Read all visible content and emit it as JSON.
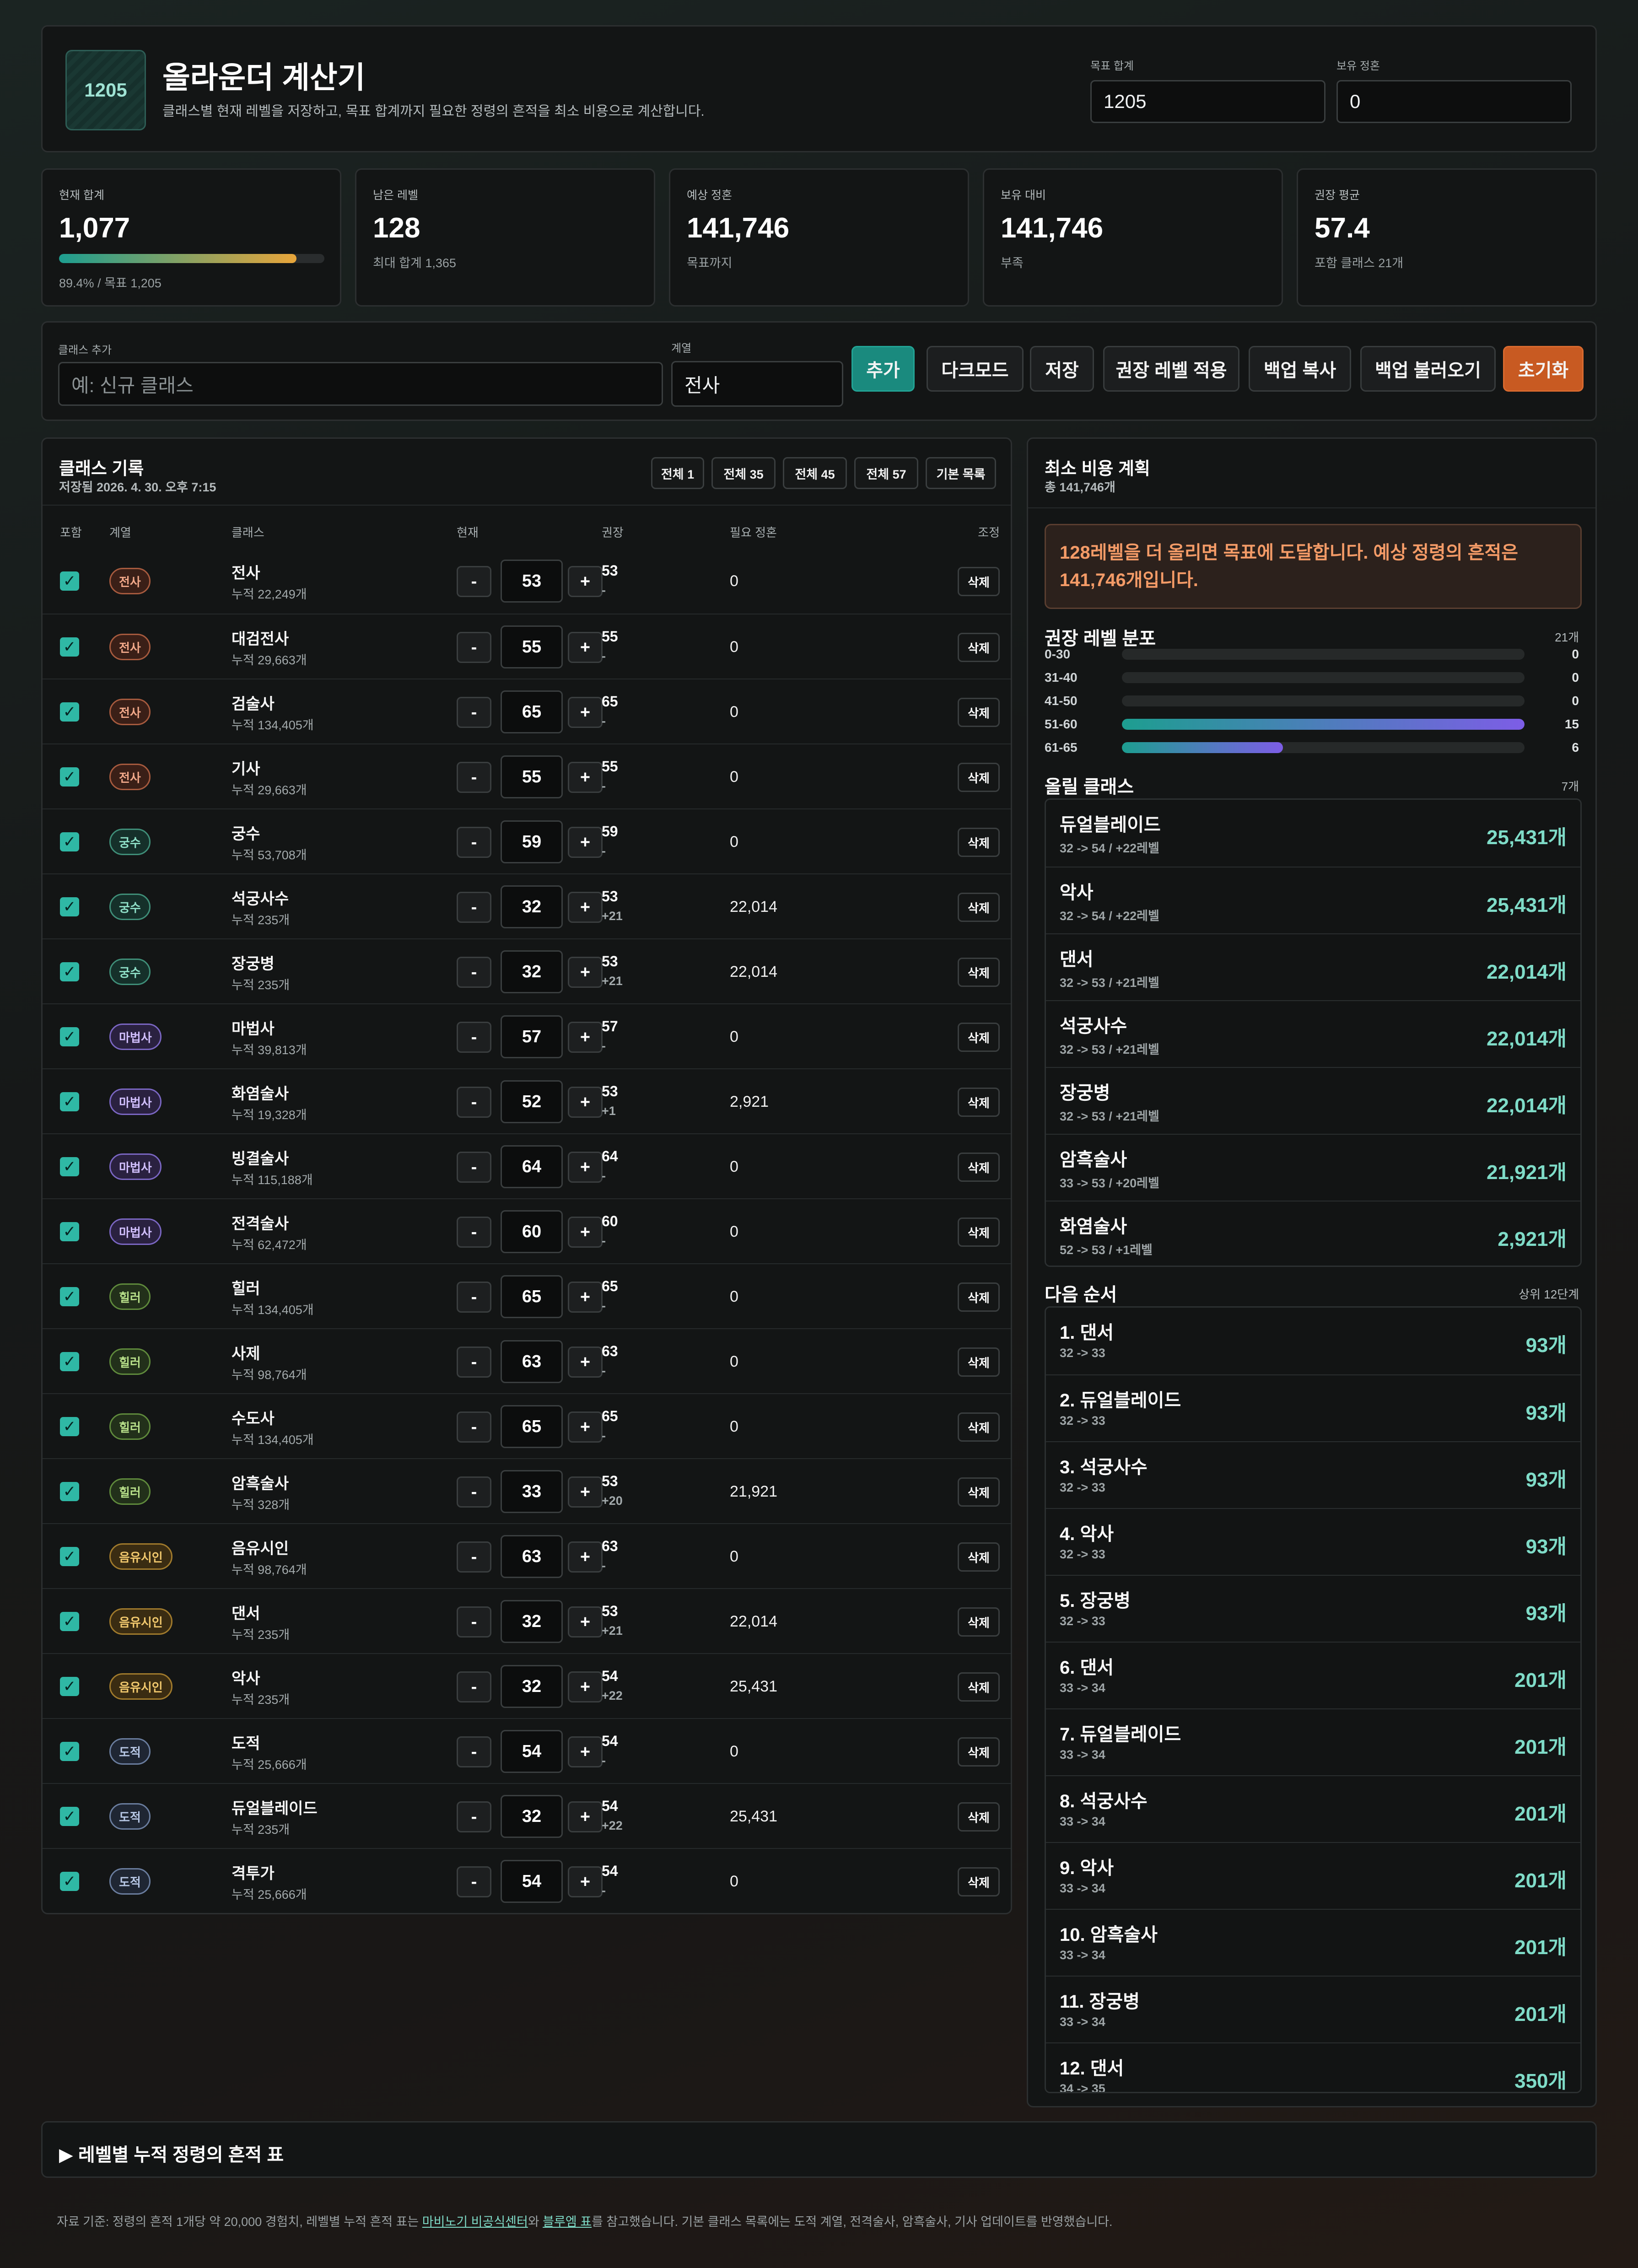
{
  "header": {
    "logo_text": "1205",
    "title": "올라운더 계산기",
    "subtitle": "클래스별 현재 레벨을 저장하고, 목표 합계까지 필요한 정령의 흔적을 최소 비용으로 계산합니다.",
    "target_label": "목표 합계",
    "target_value": "1205",
    "owned_label": "보유 정혼",
    "owned_value": "0"
  },
  "kpis": {
    "current": {
      "title": "현재 합계",
      "value": "1,077",
      "sub": "89.4% / 목표 1,205",
      "progress": 0.894
    },
    "remaining": {
      "title": "남은 레벨",
      "value": "128",
      "sub": "최대 합계 1,365"
    },
    "expected": {
      "title": "예상 정혼",
      "value": "141,746",
      "sub": "목표까지"
    },
    "vs_owned": {
      "title": "보유 대비",
      "value": "141,746",
      "sub": "부족"
    },
    "avg": {
      "title": "권장 평균",
      "value": "57.4",
      "sub": "포함 클래스 21개"
    }
  },
  "add_bar": {
    "class_label": "클래스 추가",
    "class_placeholder": "예: 신규 클래스",
    "group_label": "계열",
    "group_value": "전사",
    "buttons": {
      "add": "추가",
      "dark": "다크모드",
      "save": "저장",
      "apply": "권장 레벨 적용",
      "backup_copy": "백업 복사",
      "backup_load": "백업 불러오기",
      "reset": "초기화"
    }
  },
  "records": {
    "title": "클래스 기록",
    "saved": "저장됨 2026. 4. 30. 오후 7:15",
    "presets": [
      "전체 1",
      "전체 35",
      "전체 45",
      "전체 57",
      "기본 목록"
    ],
    "headers": {
      "include": "포함",
      "group": "계열",
      "class": "클래스",
      "current": "현재",
      "recommend": "권장",
      "need": "필요 정혼",
      "adjust": "조정"
    },
    "minus": "-",
    "plus": "+",
    "check": "✓",
    "delete": "삭제",
    "rows": [
      {
        "group": "전사",
        "name": "전사",
        "cum": "누적 22,249개",
        "level": "53",
        "rec": "53",
        "rec_diff": "-",
        "need": "0"
      },
      {
        "group": "전사",
        "name": "대검전사",
        "cum": "누적 29,663개",
        "level": "55",
        "rec": "55",
        "rec_diff": "-",
        "need": "0"
      },
      {
        "group": "전사",
        "name": "검술사",
        "cum": "누적 134,405개",
        "level": "65",
        "rec": "65",
        "rec_diff": "-",
        "need": "0"
      },
      {
        "group": "전사",
        "name": "기사",
        "cum": "누적 29,663개",
        "level": "55",
        "rec": "55",
        "rec_diff": "-",
        "need": "0"
      },
      {
        "group": "궁수",
        "name": "궁수",
        "cum": "누적 53,708개",
        "level": "59",
        "rec": "59",
        "rec_diff": "-",
        "need": "0"
      },
      {
        "group": "궁수",
        "name": "석궁사수",
        "cum": "누적 235개",
        "level": "32",
        "rec": "53",
        "rec_diff": "+21",
        "need": "22,014"
      },
      {
        "group": "궁수",
        "name": "장궁병",
        "cum": "누적 235개",
        "level": "32",
        "rec": "53",
        "rec_diff": "+21",
        "need": "22,014"
      },
      {
        "group": "마법사",
        "name": "마법사",
        "cum": "누적 39,813개",
        "level": "57",
        "rec": "57",
        "rec_diff": "-",
        "need": "0"
      },
      {
        "group": "마법사",
        "name": "화염술사",
        "cum": "누적 19,328개",
        "level": "52",
        "rec": "53",
        "rec_diff": "+1",
        "need": "2,921"
      },
      {
        "group": "마법사",
        "name": "빙결술사",
        "cum": "누적 115,188개",
        "level": "64",
        "rec": "64",
        "rec_diff": "-",
        "need": "0"
      },
      {
        "group": "마법사",
        "name": "전격술사",
        "cum": "누적 62,472개",
        "level": "60",
        "rec": "60",
        "rec_diff": "-",
        "need": "0"
      },
      {
        "group": "힐러",
        "name": "힐러",
        "cum": "누적 134,405개",
        "level": "65",
        "rec": "65",
        "rec_diff": "-",
        "need": "0"
      },
      {
        "group": "힐러",
        "name": "사제",
        "cum": "누적 98,764개",
        "level": "63",
        "rec": "63",
        "rec_diff": "-",
        "need": "0"
      },
      {
        "group": "힐러",
        "name": "수도사",
        "cum": "누적 134,405개",
        "level": "65",
        "rec": "65",
        "rec_diff": "-",
        "need": "0"
      },
      {
        "group": "힐러",
        "name": "암흑술사",
        "cum": "누적 328개",
        "level": "33",
        "rec": "53",
        "rec_diff": "+20",
        "need": "21,921"
      },
      {
        "group": "음유시인",
        "name": "음유시인",
        "cum": "누적 98,764개",
        "level": "63",
        "rec": "63",
        "rec_diff": "-",
        "need": "0"
      },
      {
        "group": "음유시인",
        "name": "댄서",
        "cum": "누적 235개",
        "level": "32",
        "rec": "53",
        "rec_diff": "+21",
        "need": "22,014"
      },
      {
        "group": "음유시인",
        "name": "악사",
        "cum": "누적 235개",
        "level": "32",
        "rec": "54",
        "rec_diff": "+22",
        "need": "25,431"
      },
      {
        "group": "도적",
        "name": "도적",
        "cum": "누적 25,666개",
        "level": "54",
        "rec": "54",
        "rec_diff": "-",
        "need": "0"
      },
      {
        "group": "도적",
        "name": "듀얼블레이드",
        "cum": "누적 235개",
        "level": "32",
        "rec": "54",
        "rec_diff": "+22",
        "need": "25,431"
      },
      {
        "group": "도적",
        "name": "격투가",
        "cum": "누적 25,666개",
        "level": "54",
        "rec": "54",
        "rec_diff": "-",
        "need": "0"
      }
    ]
  },
  "group_colors": {
    "전사": {
      "fg": "#f2a98a",
      "bg": "#3a1f17",
      "border": "#a65a3e"
    },
    "궁수": {
      "fg": "#8fe0c8",
      "bg": "#15302a",
      "border": "#3f8e78"
    },
    "마법사": {
      "fg": "#d2c0ff",
      "bg": "#2a2140",
      "border": "#7a66c2"
    },
    "힐러": {
      "fg": "#b8e08a",
      "bg": "#22301a",
      "border": "#5f8a3c"
    },
    "음유시인": {
      "fg": "#f2c96e",
      "bg": "#3a2c12",
      "border": "#a07a2c"
    },
    "도적": {
      "fg": "#b8c8e6",
      "bg": "#1f2633",
      "border": "#6a7d9e"
    }
  },
  "plan": {
    "title": "최소 비용 계획",
    "total": "총 141,746개",
    "notice": "128레벨을 더 올리면 목표에 도달합니다. 예상 정령의 흔적은 141,746개입니다.",
    "dist_title": "권장 레벨 분포",
    "dist_count": "21개",
    "dist": [
      {
        "label": "0-30",
        "value": "0",
        "frac": 0
      },
      {
        "label": "31-40",
        "value": "0",
        "frac": 0
      },
      {
        "label": "41-50",
        "value": "0",
        "frac": 0
      },
      {
        "label": "51-60",
        "value": "15",
        "frac": 1.0
      },
      {
        "label": "61-65",
        "value": "6",
        "frac": 0.4
      }
    ],
    "raise_title": "올릴 클래스",
    "raise_count": "7개",
    "raise": [
      {
        "name": "듀얼블레이드",
        "sub": "32 -> 54 / +22레벨",
        "value": "25,431개"
      },
      {
        "name": "악사",
        "sub": "32 -> 54 / +22레벨",
        "value": "25,431개"
      },
      {
        "name": "댄서",
        "sub": "32 -> 53 / +21레벨",
        "value": "22,014개"
      },
      {
        "name": "석궁사수",
        "sub": "32 -> 53 / +21레벨",
        "value": "22,014개"
      },
      {
        "name": "장궁병",
        "sub": "32 -> 53 / +21레벨",
        "value": "22,014개"
      },
      {
        "name": "암흑술사",
        "sub": "33 -> 53 / +20레벨",
        "value": "21,921개"
      },
      {
        "name": "화염술사",
        "sub": "52 -> 53 / +1레벨",
        "value": "2,921개"
      }
    ],
    "next_title": "다음 순서",
    "next_count": "상위 12단계",
    "next": [
      {
        "name": "1. 댄서",
        "sub": "32 -> 33",
        "value": "93개"
      },
      {
        "name": "2. 듀얼블레이드",
        "sub": "32 -> 33",
        "value": "93개"
      },
      {
        "name": "3. 석궁사수",
        "sub": "32 -> 33",
        "value": "93개"
      },
      {
        "name": "4. 악사",
        "sub": "32 -> 33",
        "value": "93개"
      },
      {
        "name": "5. 장궁병",
        "sub": "32 -> 33",
        "value": "93개"
      },
      {
        "name": "6. 댄서",
        "sub": "33 -> 34",
        "value": "201개"
      },
      {
        "name": "7. 듀얼블레이드",
        "sub": "33 -> 34",
        "value": "201개"
      },
      {
        "name": "8. 석궁사수",
        "sub": "33 -> 34",
        "value": "201개"
      },
      {
        "name": "9. 악사",
        "sub": "33 -> 34",
        "value": "201개"
      },
      {
        "name": "10. 암흑술사",
        "sub": "33 -> 34",
        "value": "201개"
      },
      {
        "name": "11. 장궁병",
        "sub": "33 -> 34",
        "value": "201개"
      },
      {
        "name": "12. 댄서",
        "sub": "34 -> 35",
        "value": "350개"
      }
    ]
  },
  "table_toggle": "▶ 레벨별 누적 정령의 흔적 표",
  "footer": {
    "pre": "자료 기준: 정령의 흔적 1개당 약 20,000 경험치, 레벨별 누적 흔적 표는 ",
    "link1": "마비노기 비공식센터",
    "mid": "와 ",
    "link2": "블루엠 표",
    "post": "를 참고했습니다. 기본 클래스 목록에는 도적 계열, 전격술사, 암흑술사, 기사 업데이트를 반영했습니다."
  }
}
